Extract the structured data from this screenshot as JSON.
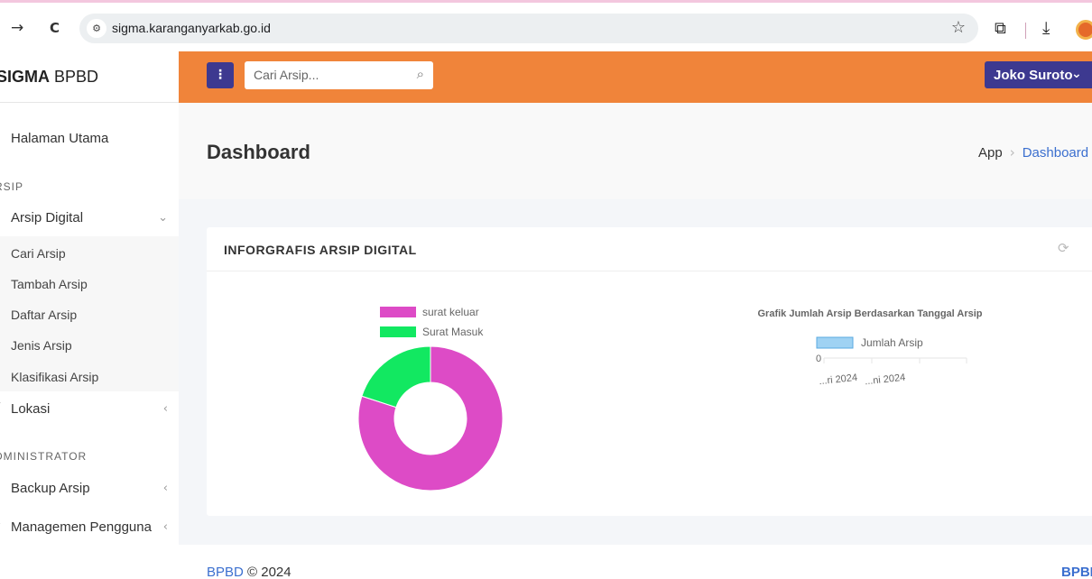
{
  "browser": {
    "back_glyph": "→",
    "reload_glyph": "C",
    "site_info_glyph": "⚙",
    "url": "sigma.karanganyarkab.go.id",
    "star_glyph": "☆",
    "extension_glyph": "⧉",
    "download_glyph": "⤓"
  },
  "sidebar": {
    "brand_bold": "SIGMA",
    "brand_rest": " BPBD",
    "home_label": "Halaman Utama",
    "section_arsip": "RSIP",
    "arsip_digital_label": "Arsip Digital",
    "chev_down": "⌄",
    "chev_left": "‹",
    "submenu": [
      "Cari Arsip",
      "Tambah Arsip",
      "Daftar Arsip",
      "Jenis Arsip",
      "Klasifikasi Arsip"
    ],
    "lokasi_label": "Lokasi",
    "section_admin": "DMINISTRATOR",
    "backup_label": "Backup Arsip",
    "user_mgmt_label": "Managemen Pengguna"
  },
  "topbar": {
    "menu_glyph": "⋮",
    "search_placeholder": "Cari Arsip...",
    "search_glyph": "⌕",
    "user_name": "Joko Suroto",
    "user_chev": "⌄"
  },
  "header": {
    "title": "Dashboard",
    "crumb_app": "App",
    "crumb_sep": "›",
    "crumb_current": "Dashboard"
  },
  "card": {
    "title": "INFORGRAFIS ARSIP DIGITAL",
    "refresh_glyph": "⟳"
  },
  "chart_data": [
    {
      "type": "pie",
      "series": [
        {
          "name": "surat keluar",
          "value": 80,
          "color": "#dd4bc6"
        },
        {
          "name": "Surat Masuk",
          "value": 20,
          "color": "#12e861"
        }
      ]
    },
    {
      "type": "bar",
      "title": "Grafik Jumlah Arsip Berdasarkan Tanggal Arsip",
      "categories": [
        "...ri 2024",
        "...ni 2024"
      ],
      "series": [
        {
          "name": "Jumlah Arsip",
          "values": [
            0,
            0
          ],
          "color": "#9fd2f3"
        }
      ],
      "ytick": "0"
    }
  ],
  "footer": {
    "brand": "BPBD",
    "copy": " © 2024",
    "right": "BPBD"
  }
}
